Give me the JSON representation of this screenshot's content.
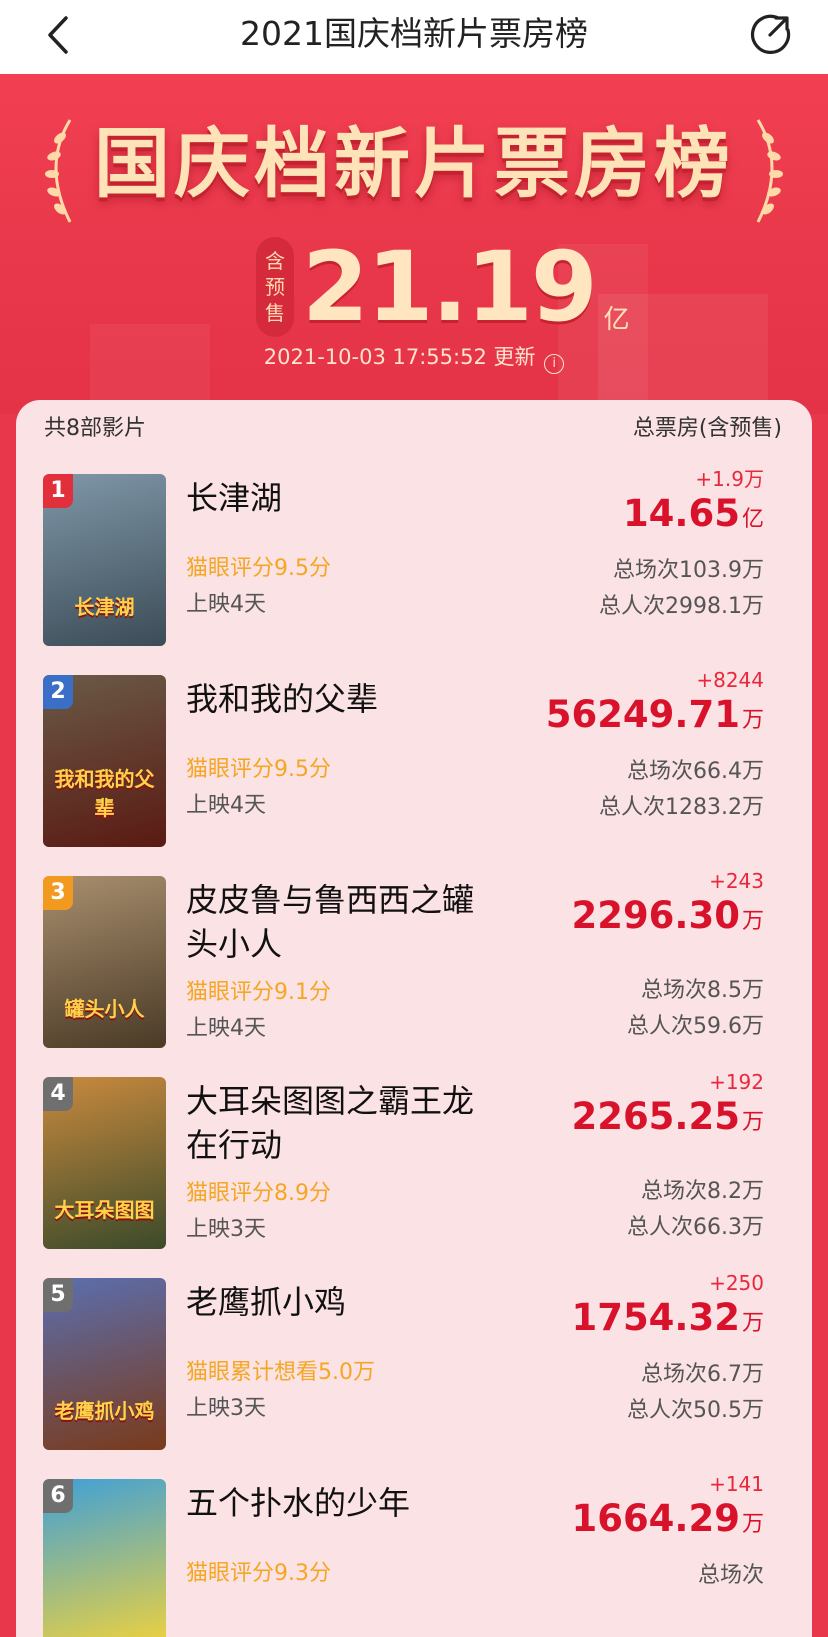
{
  "nav": {
    "title": "2021国庆档新片票房榜"
  },
  "hero": {
    "title": "国庆档新片票房榜",
    "incl_tag": [
      "含",
      "预",
      "售"
    ],
    "total": "21.19",
    "unit": "亿",
    "update_time": "2021-10-03 17:55:52 更新",
    "info_icon": "i"
  },
  "list": {
    "count_label": "共8部影片",
    "column_label": "总票房(含预售)",
    "movies": [
      {
        "rank": "1",
        "rank_color": "#e1303c",
        "title": "长津湖",
        "score": "猫眼评分9.5分",
        "days": "上映4天",
        "delta": "+1.9万",
        "box": "14.65",
        "box_unit": "亿",
        "showings": "总场次103.9万",
        "viewers": "总人次2998.1万",
        "poster_caption": "长津湖",
        "poster_colors": [
          "#7f97a8",
          "#3c4c57"
        ]
      },
      {
        "rank": "2",
        "rank_color": "#3b6fc7",
        "title": "我和我的父辈",
        "score": "猫眼评分9.5分",
        "days": "上映4天",
        "delta": "+8244",
        "box": "56249.71",
        "box_unit": "万",
        "showings": "总场次66.4万",
        "viewers": "总人次1283.2万",
        "poster_caption": "我和我的父辈",
        "poster_colors": [
          "#6a5a47",
          "#5a1a12"
        ]
      },
      {
        "rank": "3",
        "rank_color": "#f29a1f",
        "title": "皮皮鲁与鲁西西之罐头小人",
        "score": "猫眼评分9.1分",
        "days": "上映4天",
        "delta": "+243",
        "box": "2296.30",
        "box_unit": "万",
        "showings": "总场次8.5万",
        "viewers": "总人次59.6万",
        "poster_caption": "罐头小人",
        "poster_colors": [
          "#a88e6e",
          "#4a3a26"
        ]
      },
      {
        "rank": "4",
        "rank_color": "#6f6f6f",
        "title": "大耳朵图图之霸王龙在行动",
        "score": "猫眼评分8.9分",
        "days": "上映3天",
        "delta": "+192",
        "box": "2265.25",
        "box_unit": "万",
        "showings": "总场次8.2万",
        "viewers": "总人次66.3万",
        "poster_caption": "大耳朵图图",
        "poster_colors": [
          "#c98a3e",
          "#3b4a2a"
        ]
      },
      {
        "rank": "5",
        "rank_color": "#6f6f6f",
        "title": "老鹰抓小鸡",
        "score": "猫眼累计想看5.0万",
        "days": "上映3天",
        "delta": "+250",
        "box": "1754.32",
        "box_unit": "万",
        "showings": "总场次6.7万",
        "viewers": "总人次50.5万",
        "poster_caption": "老鹰抓小鸡",
        "poster_colors": [
          "#5a6fb0",
          "#7a3a1a"
        ]
      },
      {
        "rank": "6",
        "rank_color": "#6f6f6f",
        "title": "五个扑水的少年",
        "score": "猫眼评分9.3分",
        "days": "",
        "delta": "+141",
        "box": "1664.29",
        "box_unit": "万",
        "showings": "总场次",
        "viewers": "",
        "poster_caption": "",
        "poster_colors": [
          "#3fa0d8",
          "#f2d33a"
        ]
      }
    ]
  }
}
